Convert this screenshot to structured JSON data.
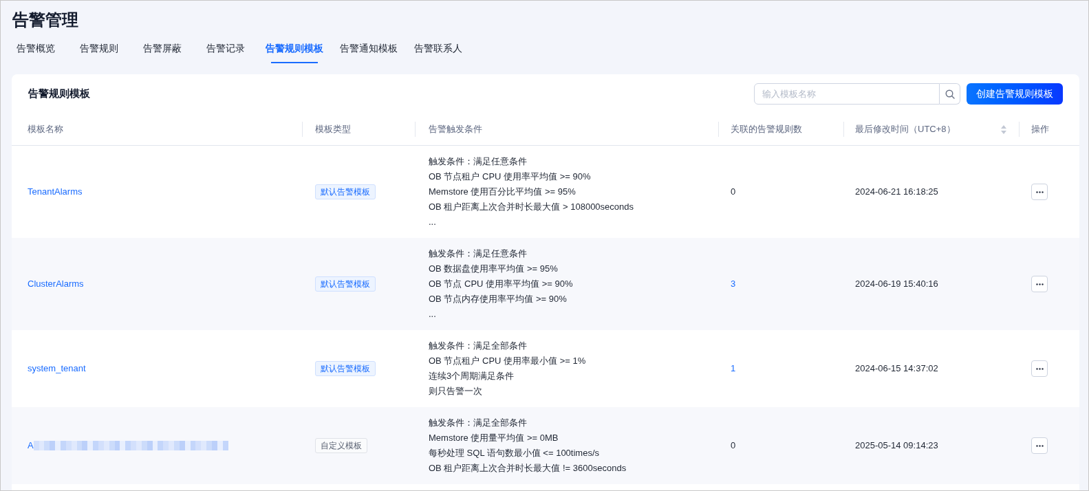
{
  "page_title": "告警管理",
  "tabs": [
    {
      "label": "告警概览",
      "selected": false
    },
    {
      "label": "告警规则",
      "selected": false
    },
    {
      "label": "告警屏蔽",
      "selected": false
    },
    {
      "label": "告警记录",
      "selected": false
    },
    {
      "label": "告警规则模板",
      "selected": true
    },
    {
      "label": "告警通知模板",
      "selected": false
    },
    {
      "label": "告警联系人",
      "selected": false
    }
  ],
  "card": {
    "title": "告警规则模板",
    "search": {
      "placeholder": "输入模板名称"
    },
    "create_button": "创建告警规则模板"
  },
  "table": {
    "columns": [
      {
        "label": "模板名称",
        "sortable": false
      },
      {
        "label": "模板类型",
        "sortable": false
      },
      {
        "label": "告警触发条件",
        "sortable": false
      },
      {
        "label": "关联的告警规则数",
        "sortable": false
      },
      {
        "label": "最后修改时间（UTC+8）",
        "sortable": true
      },
      {
        "label": "操作",
        "sortable": false
      }
    ],
    "rows": [
      {
        "name": "TenantAlarms",
        "name_redacted": false,
        "type": {
          "label": "默认告警模板",
          "kind": "default"
        },
        "conditions": [
          "触发条件：满足任意条件",
          "OB 节点租户 CPU 使用率平均值 >= 90%",
          "Memstore 使用百分比平均值 >= 95%",
          "OB 租户距离上次合并时长最大值 > 108000seconds",
          "..."
        ],
        "rule_count": {
          "text": "0",
          "link": false
        },
        "modified": "2024-06-21 16:18:25"
      },
      {
        "name": "ClusterAlarms",
        "name_redacted": false,
        "type": {
          "label": "默认告警模板",
          "kind": "default"
        },
        "conditions": [
          "触发条件：满足任意条件",
          "OB 数据盘使用率平均值 >= 95%",
          "OB 节点 CPU 使用率平均值 >= 90%",
          "OB 节点内存使用率平均值 >= 90%",
          "..."
        ],
        "rule_count": {
          "text": "3",
          "link": true
        },
        "modified": "2024-06-19 15:40:16"
      },
      {
        "name": "system_tenant",
        "name_redacted": false,
        "type": {
          "label": "默认告警模板",
          "kind": "default"
        },
        "conditions": [
          "触发条件：满足全部条件",
          "OB 节点租户 CPU 使用率最小值 >= 1%",
          "连续3个周期满足条件",
          "则只告警一次"
        ],
        "rule_count": {
          "text": "1",
          "link": true
        },
        "modified": "2024-06-15 14:37:02"
      },
      {
        "name": "A",
        "name_redacted": true,
        "type": {
          "label": "自定义模板",
          "kind": "custom"
        },
        "conditions": [
          "触发条件：满足全部条件",
          "Memstore 使用量平均值 >= 0MB",
          "每秒处理 SQL 语句数最小值 <= 100times/s",
          "OB 租户距离上次合并时长最大值 != 3600seconds"
        ],
        "rule_count": {
          "text": "0",
          "link": false
        },
        "modified": "2025-05-14 09:14:23"
      }
    ]
  }
}
